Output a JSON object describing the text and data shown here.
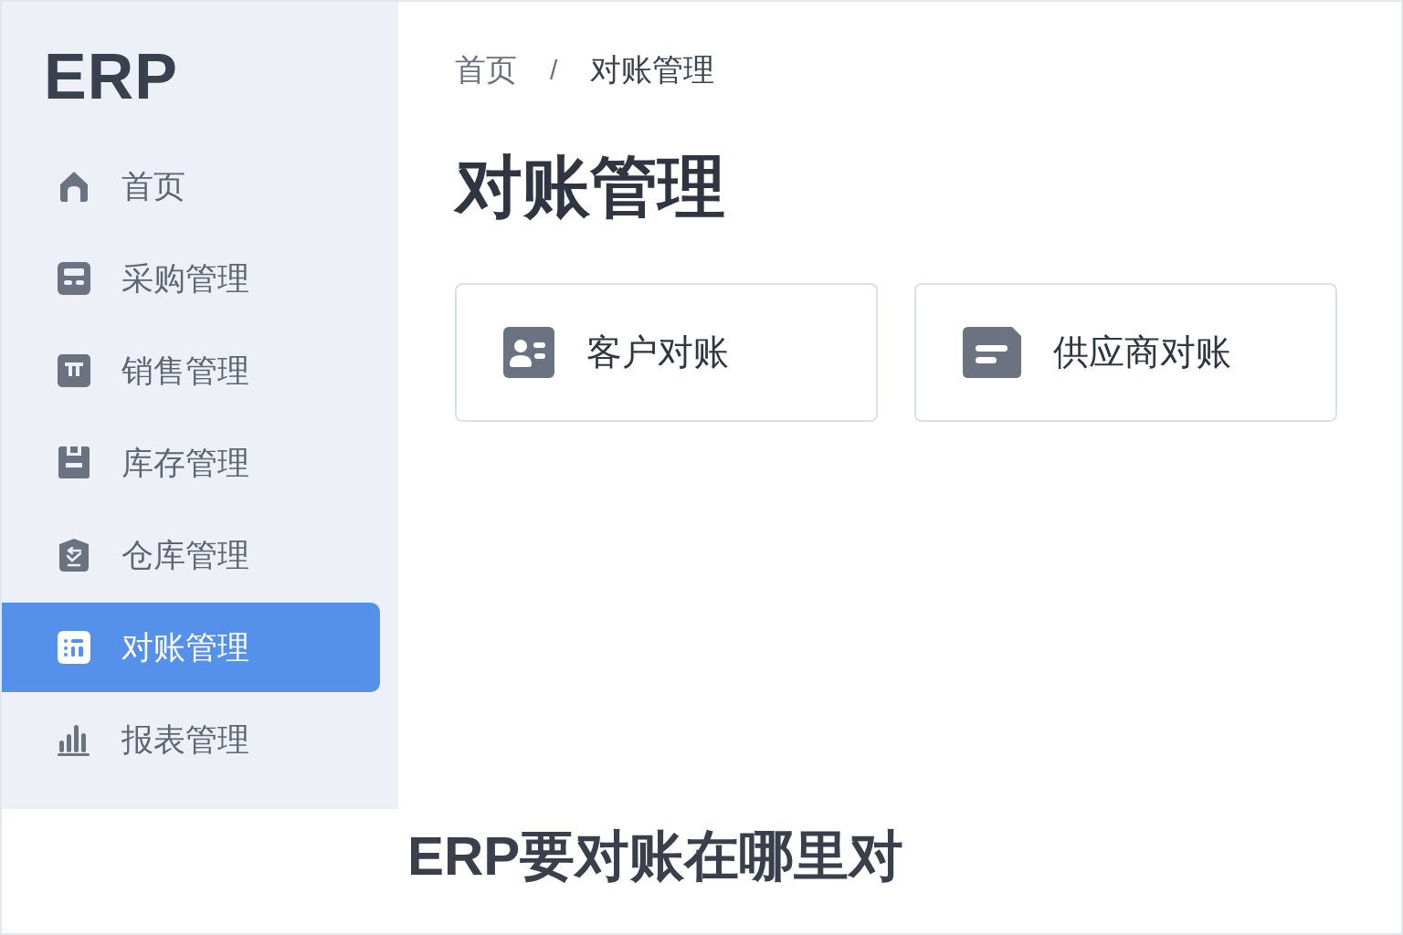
{
  "sidebar": {
    "logo": "ERP",
    "items": [
      {
        "label": "首页",
        "selected": false
      },
      {
        "label": "采购管理",
        "selected": false
      },
      {
        "label": "销售管理",
        "selected": false
      },
      {
        "label": "库存管理",
        "selected": false
      },
      {
        "label": "仓库管理",
        "selected": false
      },
      {
        "label": "对账管理",
        "selected": true
      },
      {
        "label": "报表管理",
        "selected": false
      }
    ]
  },
  "breadcrumb": {
    "items": [
      "首页",
      "对账管理"
    ],
    "separator": "/"
  },
  "page_title": "对账管理",
  "cards": [
    {
      "label": "客户对账"
    },
    {
      "label": "供应商对账"
    }
  ],
  "caption": "ERP要对账在哪里对"
}
